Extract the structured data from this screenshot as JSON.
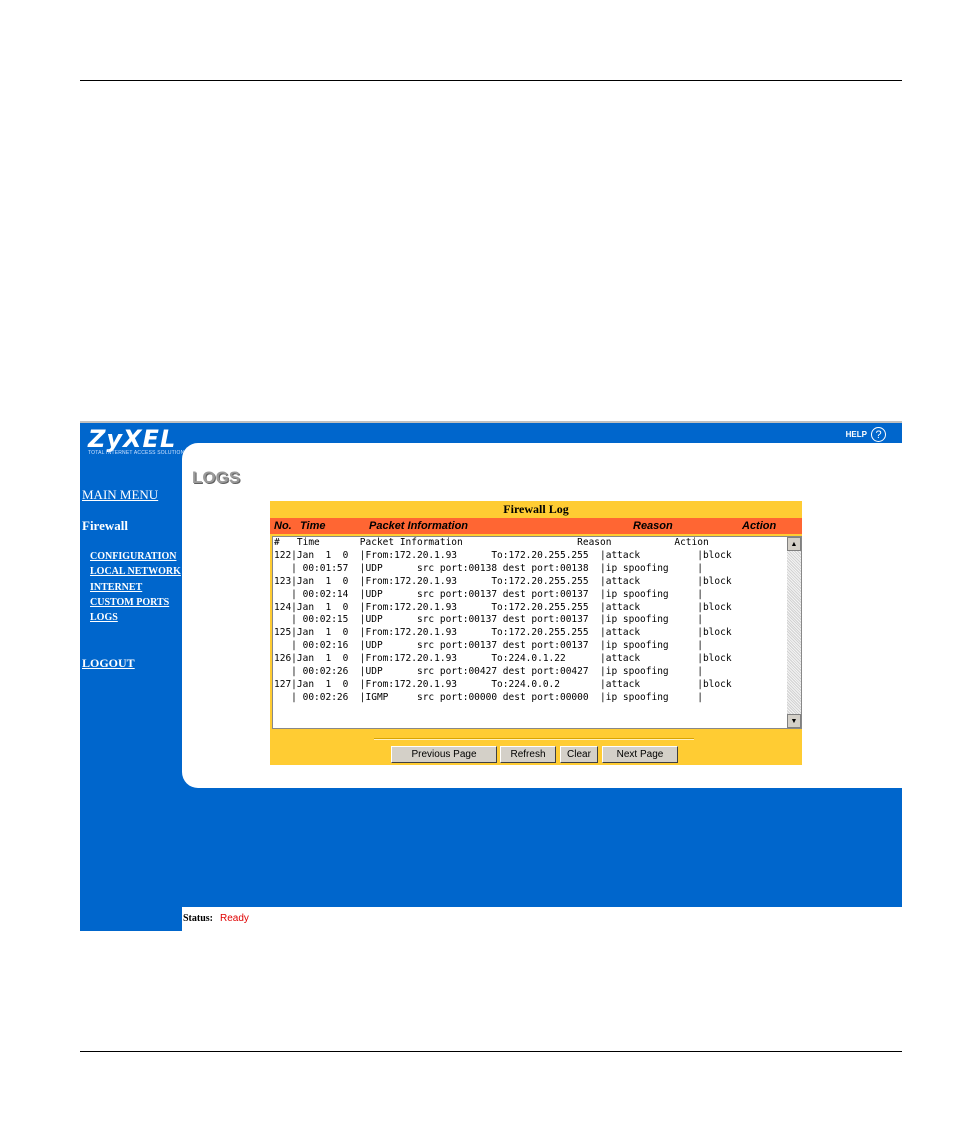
{
  "branding": {
    "logo_text": "ZyXEL",
    "tagline": "Total Internet Access Solution"
  },
  "header": {
    "help_label": "HELP",
    "help_glyph": "?"
  },
  "nav": {
    "main_menu": "MAIN MENU",
    "section": "Firewall",
    "items": [
      "CONFIGURATION",
      "LOCAL NETWORK",
      "INTERNET",
      "CUSTOM PORTS",
      "LOGS"
    ],
    "logout": "LOGOUT"
  },
  "page_title": "LOGS",
  "firewall_log": {
    "title": "Firewall Log",
    "columns": [
      "No.",
      "Time",
      "Packet Information",
      "Reason",
      "Action"
    ],
    "log_lines": [
      "#   Time       Packet Information                    Reason           Action",
      "122|Jan  1  0  |From:172.20.1.93      To:172.20.255.255  |attack          |block",
      "   | 00:01:57  |UDP      src port:00138 dest port:00138  |ip spoofing     |",
      "123|Jan  1  0  |From:172.20.1.93      To:172.20.255.255  |attack          |block",
      "   | 00:02:14  |UDP      src port:00137 dest port:00137  |ip spoofing     |",
      "124|Jan  1  0  |From:172.20.1.93      To:172.20.255.255  |attack          |block",
      "   | 00:02:15  |UDP      src port:00137 dest port:00137  |ip spoofing     |",
      "125|Jan  1  0  |From:172.20.1.93      To:172.20.255.255  |attack          |block",
      "   | 00:02:16  |UDP      src port:00137 dest port:00137  |ip spoofing     |",
      "126|Jan  1  0  |From:172.20.1.93      To:224.0.1.22      |attack          |block",
      "   | 00:02:26  |UDP      src port:00427 dest port:00427  |ip spoofing     |",
      "127|Jan  1  0  |From:172.20.1.93      To:224.0.0.2       |attack          |block",
      "   | 00:02:26  |IGMP     src port:00000 dest port:00000  |ip spoofing     |"
    ]
  },
  "buttons": {
    "previous": "Previous Page",
    "refresh": "Refresh",
    "clear": "Clear",
    "next": "Next Page"
  },
  "status": {
    "label": "Status:",
    "value": "Ready"
  },
  "colors": {
    "frame_bg": "#0066cc",
    "log_box": "#ffcc33",
    "header_bar": "#ff6633",
    "status_value": "#e00000"
  }
}
